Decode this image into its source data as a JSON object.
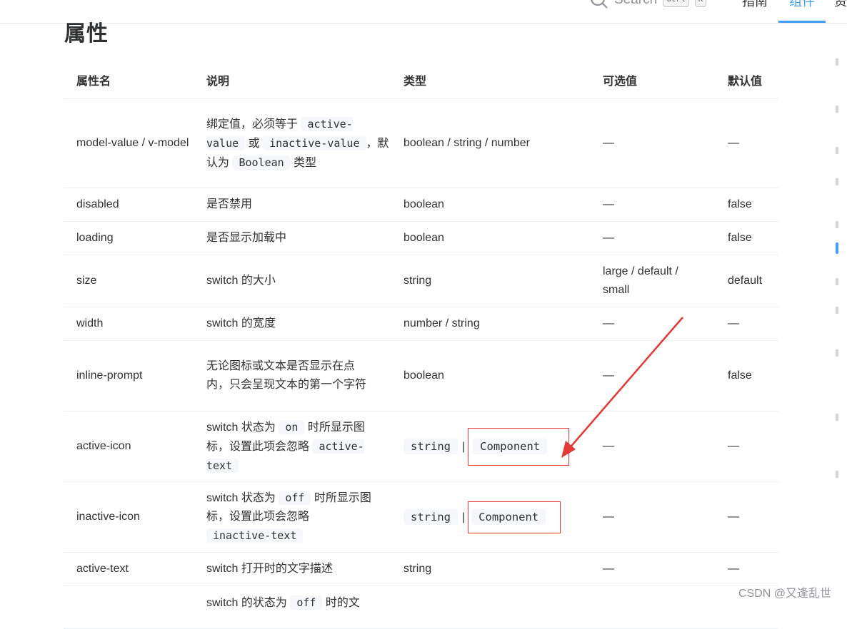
{
  "nav": {
    "search_label": "Search",
    "kbd_1": "Ctrl",
    "kbd_2": "K",
    "link_1": "指南",
    "link_2": "组件",
    "link_3": "资"
  },
  "section_title": "属性",
  "table": {
    "headers": [
      "属性名",
      "说明",
      "类型",
      "可选值",
      "默认值"
    ],
    "rows": [
      {
        "name": "model-value / v-model",
        "desc_parts": [
          "绑定值，必须等于 ",
          "active-value",
          " 或 ",
          "inactive-value",
          "，默认为 ",
          "Boolean",
          " 类型"
        ],
        "type": "boolean / string / number",
        "options": "—",
        "default": "—"
      },
      {
        "name": "disabled",
        "desc": "是否禁用",
        "type": "boolean",
        "options": "—",
        "default": "false"
      },
      {
        "name": "loading",
        "desc": "是否显示加载中",
        "type": "boolean",
        "options": "—",
        "default": "false"
      },
      {
        "name": "size",
        "desc": "switch 的大小",
        "type": "string",
        "options": "large / default / small",
        "default": "default"
      },
      {
        "name": "width",
        "desc": "switch 的宽度",
        "type": "number / string",
        "options": "—",
        "default": "—"
      },
      {
        "name": "inline-prompt",
        "desc": "无论图标或文本是否显示在点内，只会呈现文本的第一个字符",
        "type": "boolean",
        "options": "—",
        "default": "false"
      },
      {
        "name": "active-icon",
        "desc_parts": [
          "switch 状态为 ",
          "on",
          " 时所显示图标，设置此项会忽略 ",
          "active-text"
        ],
        "type_parts": [
          "string",
          "|",
          "Component"
        ],
        "options": "—",
        "default": "—"
      },
      {
        "name": "inactive-icon",
        "desc_parts": [
          "switch 状态为 ",
          "off",
          " 时所显示图标，设置此项会忽略 ",
          "inactive-text"
        ],
        "type_parts": [
          "string",
          "|",
          "Component"
        ],
        "options": "—",
        "default": "—"
      },
      {
        "name": "active-text",
        "desc": "switch 打开时的文字描述",
        "type": "string",
        "options": "—",
        "default": "—"
      },
      {
        "name": "",
        "desc_parts": [
          "switch 的状态为 ",
          "off",
          " 时的文"
        ],
        "type": "",
        "options": "",
        "default": ""
      }
    ]
  },
  "watermark": "CSDN @又逢乱世",
  "colors": {
    "accent": "#409eff",
    "annotation_red": "#e53935",
    "code_bg": "#f5f7fa",
    "border": "#ebeef5"
  }
}
